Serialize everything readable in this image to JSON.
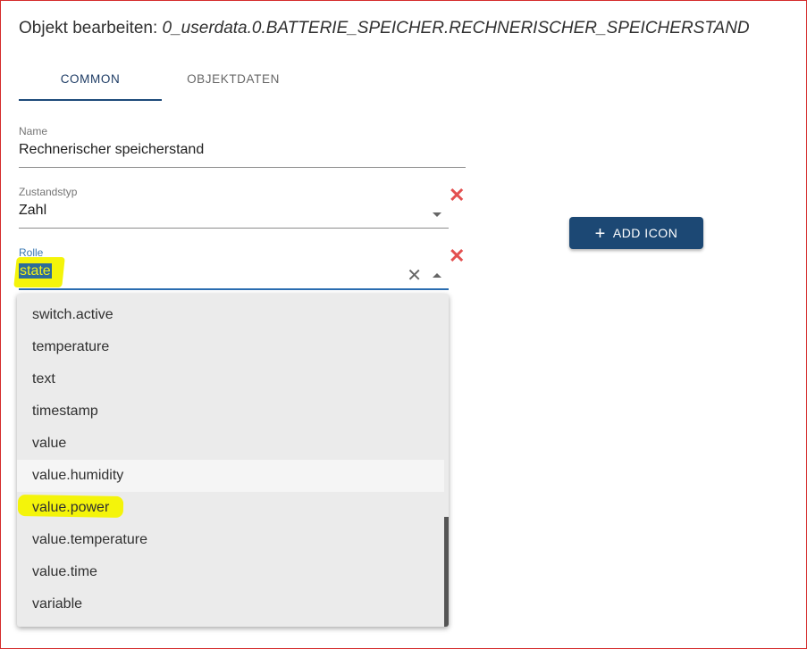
{
  "dialog": {
    "title_prefix": "Objekt bearbeiten:",
    "object_id": "0_userdata.0.BATTERIE_SPEICHER.RECHNERISCHER_SPEICHERSTAND"
  },
  "tabs": [
    {
      "label": "COMMON",
      "active": true
    },
    {
      "label": "OBJEKTDATEN",
      "active": false
    }
  ],
  "fields": {
    "name": {
      "label": "Name",
      "value": "Rechnerischer speicherstand"
    },
    "state_type": {
      "label": "Zustandstyp",
      "value": "Zahl"
    },
    "role": {
      "label": "Rolle",
      "value": "state"
    }
  },
  "add_icon_button": {
    "label": "ADD ICON",
    "icon": "plus-icon"
  },
  "role_options": [
    {
      "label": "switch.active"
    },
    {
      "label": "temperature"
    },
    {
      "label": "text"
    },
    {
      "label": "timestamp"
    },
    {
      "label": "value"
    },
    {
      "label": "value.humidity",
      "hover": true
    },
    {
      "label": "value.power",
      "highlighted": true
    },
    {
      "label": "value.temperature"
    },
    {
      "label": "value.time"
    },
    {
      "label": "variable"
    }
  ],
  "colors": {
    "accent": "#1c4874",
    "focus": "#2a6db0",
    "delete": "#e35050",
    "highlight": "#f4f40a",
    "frame": "#d42b2b"
  }
}
